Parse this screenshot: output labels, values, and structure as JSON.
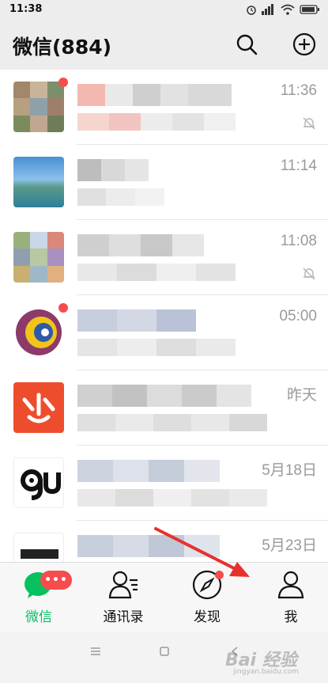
{
  "status_bar": {
    "time": "11:38"
  },
  "header": {
    "title": "微信(884)",
    "search_icon": "search-icon",
    "add_icon": "plus-circle-icon"
  },
  "chats": [
    {
      "time": "11:36",
      "muted": true,
      "unread_dot": true
    },
    {
      "time": "11:14",
      "muted": false,
      "unread_dot": false
    },
    {
      "time": "11:08",
      "muted": true,
      "unread_dot": false
    },
    {
      "time": "05:00",
      "muted": false,
      "unread_dot": true
    },
    {
      "time": "昨天",
      "muted": false,
      "unread_dot": false
    },
    {
      "time": "5月18日",
      "muted": false,
      "unread_dot": false
    },
    {
      "time": "5月23日",
      "muted": false,
      "unread_dot": false
    }
  ],
  "tabs": [
    {
      "label": "微信",
      "icon": "chat-bubble-icon",
      "badge": "•••",
      "active": true
    },
    {
      "label": "通讯录",
      "icon": "contacts-icon"
    },
    {
      "label": "发现",
      "icon": "compass-icon"
    },
    {
      "label": "我",
      "icon": "person-icon"
    }
  ],
  "watermark": {
    "text": "Bai 经验",
    "sub": "jingyan.baidu.com"
  },
  "colors": {
    "accent": "#07c160",
    "badge": "#f74c4c",
    "arrow": "#e8312d"
  }
}
